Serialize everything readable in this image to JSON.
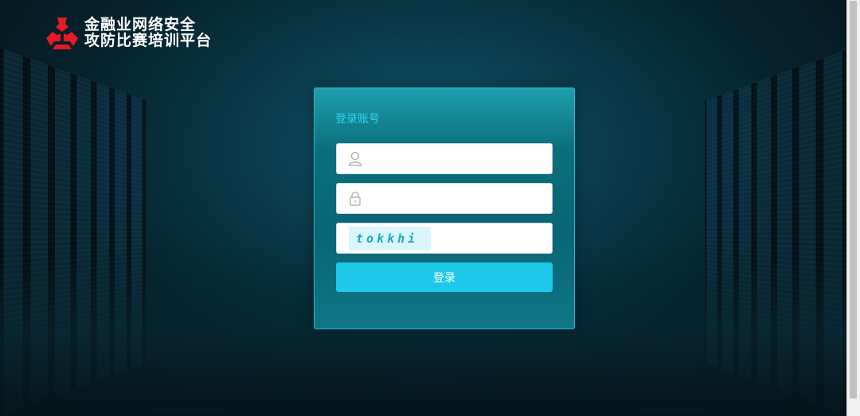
{
  "brand": {
    "line1": "金融业网络安全",
    "line2": "攻防比赛培训平台",
    "logo_color": "#e31b23"
  },
  "login": {
    "title": "登录账号",
    "username": {
      "value": "",
      "placeholder": "",
      "icon": "user-icon"
    },
    "password": {
      "value": "",
      "placeholder": "",
      "icon": "lock-icon"
    },
    "captcha": {
      "image_text": "tokkhi",
      "value": "",
      "placeholder": ""
    },
    "submit_label": "登录"
  },
  "colors": {
    "accent": "#1ec8e8",
    "title": "#2fd3ea",
    "card": "#0c6f7c"
  }
}
